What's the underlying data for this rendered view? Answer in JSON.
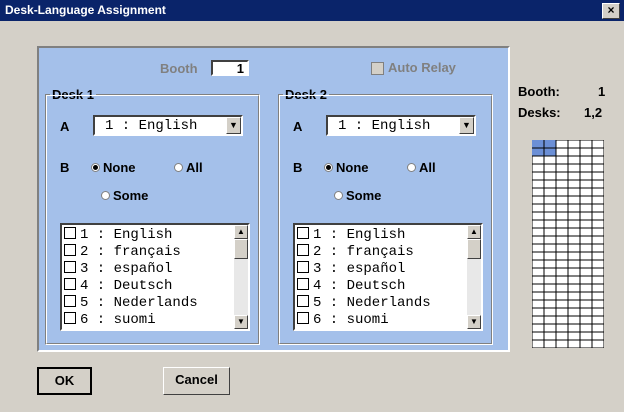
{
  "window": {
    "title": "Desk-Language Assignment",
    "close_label": "×"
  },
  "booth": {
    "label": "Booth",
    "value": "1"
  },
  "auto_relay": {
    "label": "Auto Relay"
  },
  "desks": [
    {
      "title": "Desk 1",
      "a_label": "A",
      "a_value": "1 : English",
      "b_label": "B",
      "none_label": "None",
      "all_label": "All",
      "some_label": "Some",
      "languages": [
        "1 : English",
        "2 : français",
        "3 : español",
        "4 : Deutsch",
        "5 : Nederlands",
        "6 : suomi"
      ]
    },
    {
      "title": "Desk 2",
      "a_label": "A",
      "a_value": "1 : English",
      "b_label": "B",
      "none_label": "None",
      "all_label": "All",
      "some_label": "Some",
      "languages": [
        "1 : English",
        "2 : français",
        "3 : español",
        "4 : Deutsch",
        "5 : Nederlands",
        "6 : suomi"
      ]
    }
  ],
  "summary": {
    "booth_label": "Booth:",
    "booth_value": "1",
    "desks_label": "Desks:",
    "desks_value": "1,2"
  },
  "buttons": {
    "ok": "OK",
    "cancel": "Cancel"
  },
  "colors": {
    "panel": "#a4c0ea",
    "titlebar": "#0a246a",
    "grid_selected": "#6b8fd6"
  }
}
